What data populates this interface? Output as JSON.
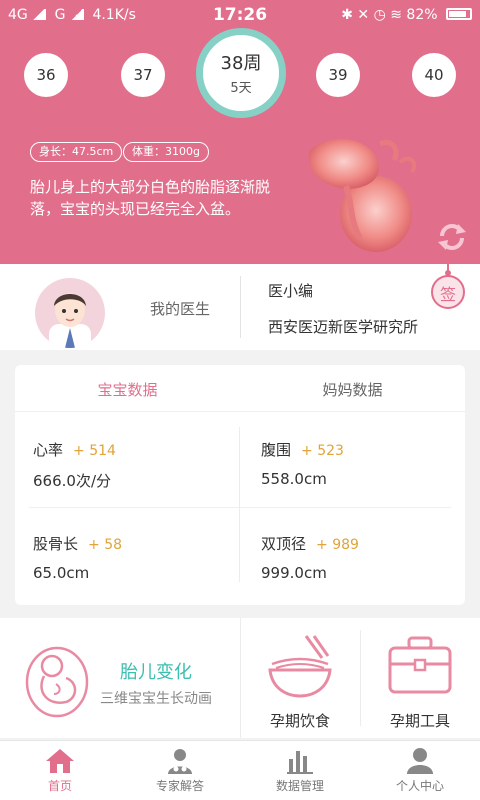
{
  "status_bar": {
    "network1": "4G",
    "network2": "G",
    "speed": "4.1K/s",
    "time": "17:26",
    "battery": "82%"
  },
  "weeks": {
    "prev2": "36",
    "prev1": "37",
    "current_week": "38周",
    "current_days": "5天",
    "next1": "39",
    "next2": "40"
  },
  "fetus": {
    "length": "身长：47.5cm",
    "weight": "体重：3100g",
    "description": "胎儿身上的大部分白色的胎脂逐渐脱落，宝宝的头现已经完全入盆。"
  },
  "doctor": {
    "my_doctor_label": "我的医生",
    "name": "医小编",
    "organization": "西安医迈新医学研究所",
    "sign_label": "签"
  },
  "data_tabs": {
    "baby": "宝宝数据",
    "mom": "妈妈数据"
  },
  "metrics": [
    {
      "name": "心率",
      "delta": "+ 514",
      "value": "666.0次/分"
    },
    {
      "name": "腹围",
      "delta": "+ 523",
      "value": "558.0cm"
    },
    {
      "name": "股骨长",
      "delta": "+ 58",
      "value": "65.0cm"
    },
    {
      "name": "双顶径",
      "delta": "+ 989",
      "value": "999.0cm"
    }
  ],
  "features": {
    "fetal_change_title": "胎儿变化",
    "fetal_change_subtitle": "三维宝宝生长动画",
    "diet_label": "孕期饮食",
    "tools_label": "孕期工具"
  },
  "nav": [
    {
      "label": "首页",
      "icon": "home-icon"
    },
    {
      "label": "专家解答",
      "icon": "doctor-icon"
    },
    {
      "label": "数据管理",
      "icon": "bar-chart-icon"
    },
    {
      "label": "个人中心",
      "icon": "user-icon"
    }
  ],
  "colors": {
    "primary_pink": "#e16f8c",
    "teal": "#3bbfb1",
    "ring_teal": "#86d0c6",
    "delta_orange": "#e0a43a"
  }
}
